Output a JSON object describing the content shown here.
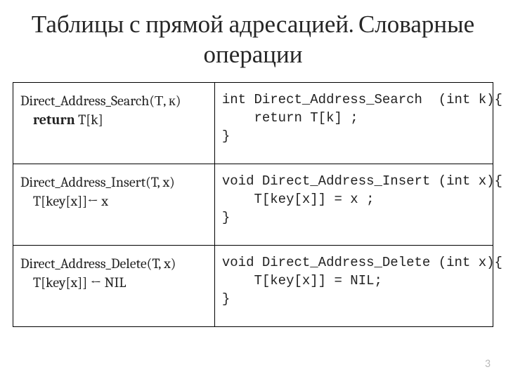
{
  "title": "Таблицы с прямой адресацией. Словарные операции",
  "rows": [
    {
      "pseudo_line1": "Direct_Address_Search(Т, к)",
      "pseudo_kw": "return",
      "pseudo_tail": " T[k]",
      "code": "int Direct_Address_Search  (int k){\n    return T[k] ;\n}"
    },
    {
      "pseudo_line1": "Direct_Address_Insert(T, x)",
      "pseudo_line2": "T[key[x]]← x",
      "code": "void Direct_Address_Insert (int x){\n    T[key[x]] = x ;\n}"
    },
    {
      "pseudo_line1": "Direct_Address_Delete(T, x)",
      "pseudo_line2": "T[key[x]] ← NIL",
      "code": "void Direct_Address_Delete (int x){\n    T[key[x]] = NIL;\n}"
    }
  ],
  "page_number": "3"
}
